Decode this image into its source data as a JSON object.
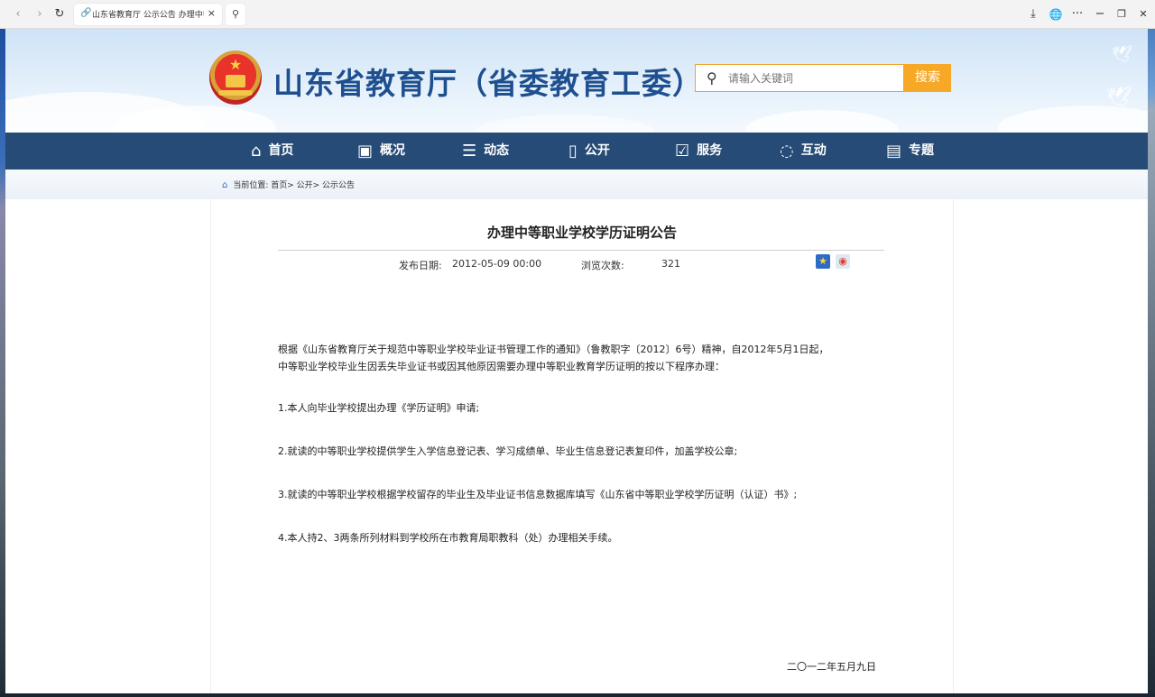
{
  "browser": {
    "tab_title": "山东省教育厅 公示公告 办理中等职业学校学历证明公告",
    "back": "‹",
    "forward": "›",
    "reload": "↻",
    "tab_icon": "link-icon",
    "close": "×",
    "search": "⚲",
    "download": "⤓",
    "globe": "🌐",
    "more": "···",
    "minimize": "−",
    "restore": "❐",
    "window_close": "✕"
  },
  "header": {
    "site_title": "山东省教育厅（省委教育工委）",
    "search_placeholder": "请输入关键词",
    "search_button": "搜索"
  },
  "nav": {
    "items": [
      {
        "icon": "home-icon",
        "glyph": "⌂",
        "label": "首页"
      },
      {
        "icon": "overview-icon",
        "glyph": "▣",
        "label": "概况"
      },
      {
        "icon": "news-icon",
        "glyph": "☰",
        "label": "动态"
      },
      {
        "icon": "book-icon",
        "glyph": "▯",
        "label": "公开"
      },
      {
        "icon": "service-icon",
        "glyph": "☑",
        "label": "服务"
      },
      {
        "icon": "chat-icon",
        "glyph": "◌",
        "label": "互动"
      },
      {
        "icon": "topic-icon",
        "glyph": "▤",
        "label": "专题"
      }
    ]
  },
  "breadcrumb": {
    "text": "当前位置: 首页> 公开> 公示公告"
  },
  "article": {
    "title": "办理中等职业学校学历证明公告",
    "date_label": "发布日期:",
    "date_value": "2012-05-09 00:00",
    "views_label": "浏览次数:",
    "views_value": "321",
    "p1_line1": "根据《山东省教育厅关于规范中等职业学校毕业证书管理工作的通知》（鲁教职字〔2012〕6号）精神，自2012年5月1日起，",
    "p1_line2": "中等职业学校毕业生因丢失毕业证书或因其他原因需要办理中等职业教育学历证明的按以下程序办理：",
    "item1": "1.本人向毕业学校提出办理《学历证明》申请;",
    "item2": "2.就读的中等职业学校提供学生入学信息登记表、学习成绩单、毕业生信息登记表复印件，加盖学校公章;",
    "item3": "3.就读的中等职业学校根据学校留存的毕业生及毕业证书信息数据库填写《山东省中等职业学校学历证明（认证）书》;",
    "item4": "4.本人持2、3两条所列材料到学校所在市教育局职教科（处）办理相关手续。",
    "signature_date": "二〇一二年五月九日"
  }
}
